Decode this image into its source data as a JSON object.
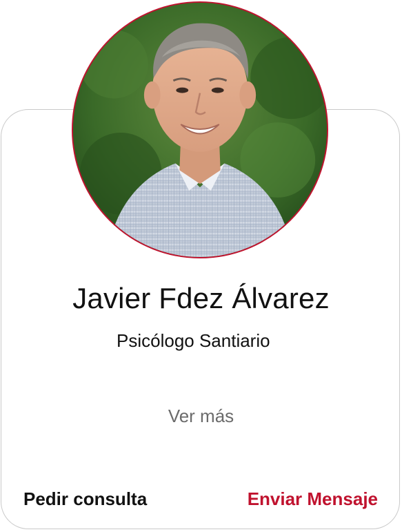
{
  "profile": {
    "name": "Javier Fdez Álvarez",
    "title": "Psicólogo Santiario",
    "more_label": "Ver más",
    "photo_alt": "avatar"
  },
  "actions": {
    "primary_label": "Pedir consulta",
    "secondary_label": "Enviar Mensaje"
  },
  "colors": {
    "accent": "#c0122e",
    "text": "#111111",
    "muted": "#6b6b6b",
    "border": "#c9c9c9"
  }
}
